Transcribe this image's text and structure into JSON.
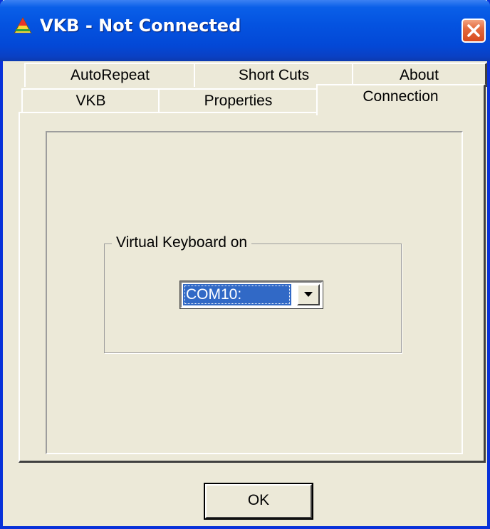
{
  "window": {
    "title": "VKB - Not Connected",
    "icon": "vkb-triangle-icon",
    "close_icon": "close-icon"
  },
  "tabs": {
    "back_row": [
      {
        "label": "AutoRepeat"
      },
      {
        "label": "Short Cuts"
      },
      {
        "label": "About"
      }
    ],
    "front_row": [
      {
        "label": "VKB"
      },
      {
        "label": "Properties"
      },
      {
        "label": "Connection"
      }
    ],
    "active": "Connection"
  },
  "connection": {
    "group_label": "Virtual Keyboard on",
    "port_select": {
      "selected": "COM10:",
      "arrow_icon": "dropdown-arrow-icon"
    }
  },
  "footer": {
    "ok_label": "OK"
  },
  "colors": {
    "titlebar": "#0453e0",
    "face": "#ece9d8",
    "selection": "#3169c6",
    "close": "#d84a1d"
  }
}
